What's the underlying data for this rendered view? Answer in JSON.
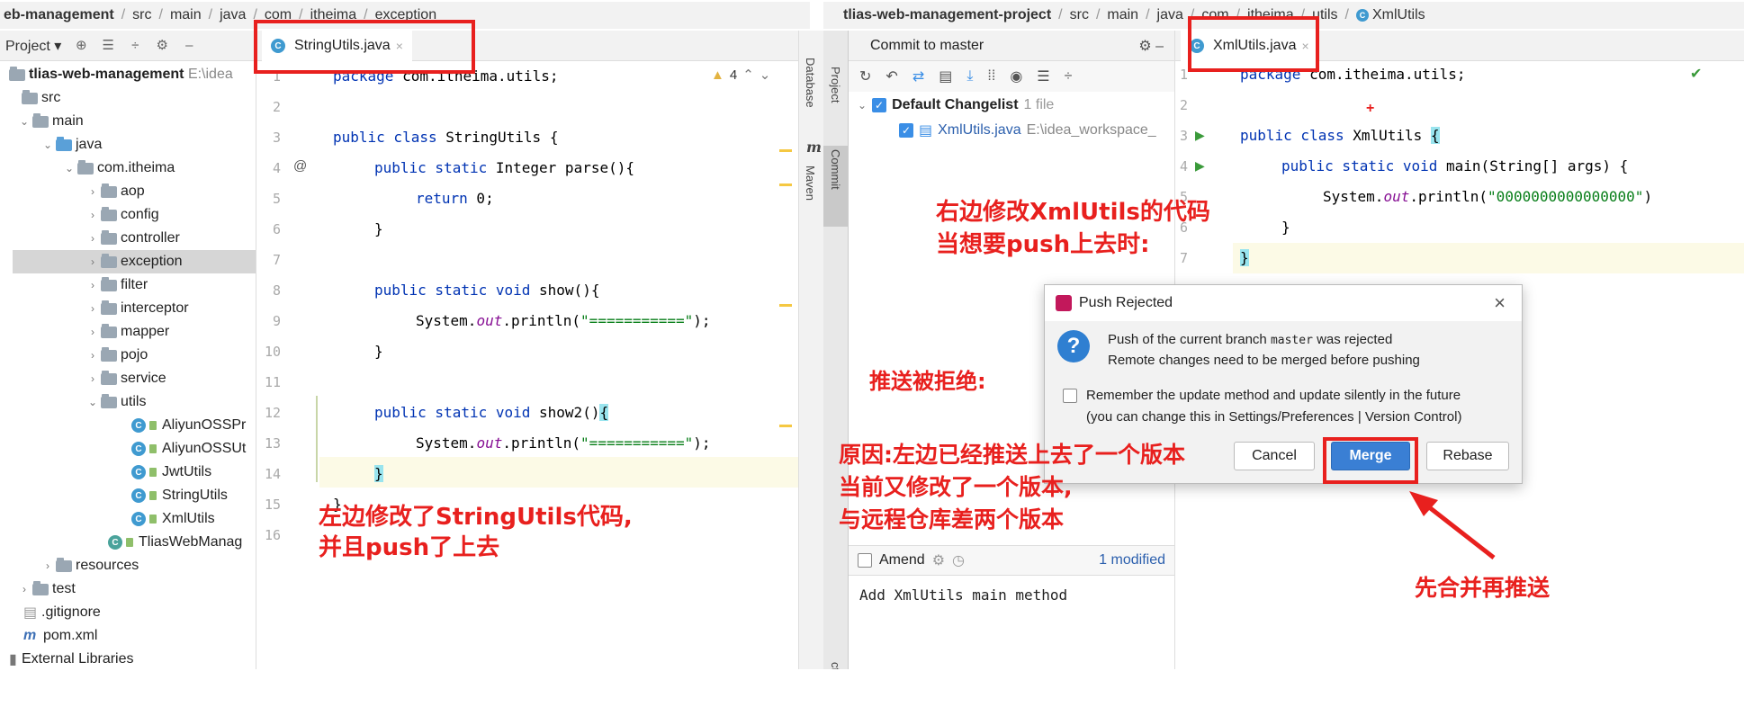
{
  "left": {
    "breadcrumb": [
      "eb-management",
      "src",
      "main",
      "java",
      "com",
      "itheima",
      "exception"
    ],
    "toolbar_label": "Project",
    "tab": "StringUtils.java",
    "warning_count": "4",
    "tree": {
      "root": "tlias-web-management",
      "root_path": "E:\\idea",
      "items": {
        "src": "src",
        "main": "main",
        "java": "java",
        "com": "com.itheima",
        "aop": "aop",
        "config": "config",
        "controller": "controller",
        "exception": "exception",
        "filter": "filter",
        "interceptor": "interceptor",
        "mapper": "mapper",
        "pojo": "pojo",
        "service": "service",
        "utils": "utils",
        "c1": "AliyunOSSPr",
        "c2": "AliyunOSSUt",
        "c3": "JwtUtils",
        "c4": "StringUtils",
        "c5": "XmlUtils",
        "app": "TliasWebManag",
        "resources": "resources",
        "test": "test",
        "gitignore": ".gitignore",
        "pom": "pom.xml",
        "libs": "External Libraries"
      }
    },
    "code": {
      "l1_kw": "package",
      "l1": " com.itheima.utils;",
      "l3_kw": "public class",
      "l3": " StringUtils {",
      "l4_kw": "public static",
      "l4": " Integer parse(){",
      "l5_kw": "return",
      "l5": " 0;",
      "l6": "}",
      "l8_kw": "public static void",
      "l8": " show(){",
      "l9_a": "System.",
      "l9_out": "out",
      "l9_b": ".println(",
      "l9_str": "\"===========\"",
      "l9_c": ");",
      "l10": "}",
      "l12_kw": "public static void",
      "l12": " show2()",
      "l12_brace": "{",
      "l13_a": "System.",
      "l13_out": "out",
      "l13_b": ".println(",
      "l13_str": "\"===========\"",
      "l13_c": ");",
      "l14": "}",
      "l15": "}"
    },
    "gutter_at": "@",
    "side_labels": [
      "Database",
      "m",
      "Maven"
    ]
  },
  "right": {
    "breadcrumb": [
      "tlias-web-management-project",
      "src",
      "main",
      "java",
      "com",
      "itheima",
      "utils",
      "XmlUtils"
    ],
    "commit_tab": "Commit to master",
    "changelist": "Default Changelist",
    "changelist_count": "1 file",
    "file": "XmlUtils.java",
    "file_path": "E:\\idea_workspace_",
    "amend": "Amend",
    "modified": "1 modified",
    "commit_message": "Add XmlUtils main method",
    "side_labels": [
      "Project",
      "Commit",
      "cture"
    ],
    "tab": "XmlUtils.java",
    "code": {
      "l1_kw": "package",
      "l1": " com.itheima.utils;",
      "l3_kw": "public class",
      "l3": " XmlUtils ",
      "l3_brace": "{",
      "l4_kw": "public static void",
      "l4": " main(String[] args) {",
      "l5_a": "System.",
      "l5_out": "out",
      "l5_b": ".println(",
      "l5_str": "\"0000000000000000\"",
      "l5_c": ")",
      "l6": "}",
      "l7": "}"
    }
  },
  "dialog": {
    "title": "Push Rejected",
    "msg1": "Push of the current branch ",
    "msg1_branch": "master",
    "msg1_end": " was rejected",
    "msg2": "Remote changes need to be merged before pushing",
    "remember1": "Remember the update method and update silently in the future",
    "remember2": "(you can change this in Settings/Preferences | Version Control)",
    "cancel": "Cancel",
    "merge": "Merge",
    "rebase": "Rebase"
  },
  "annotations": {
    "left_note1": "左边修改了StringUtils代码,",
    "left_note2": "并且push了上去",
    "right_note1": "右边修改XmlUtils的代码",
    "right_note2": "当想要push上去时:",
    "rejected": "推送被拒绝:",
    "reason1": "原因:左边已经推送上去了一个版本",
    "reason2": "当前又修改了一个版本,",
    "reason3": "与远程仓库差两个版本",
    "merge_first": "先合并再推送"
  },
  "colors": {
    "annotation": "#e8201e",
    "keyword": "#0033b3",
    "string": "#067d17",
    "button_primary": "#3a7fd4"
  }
}
